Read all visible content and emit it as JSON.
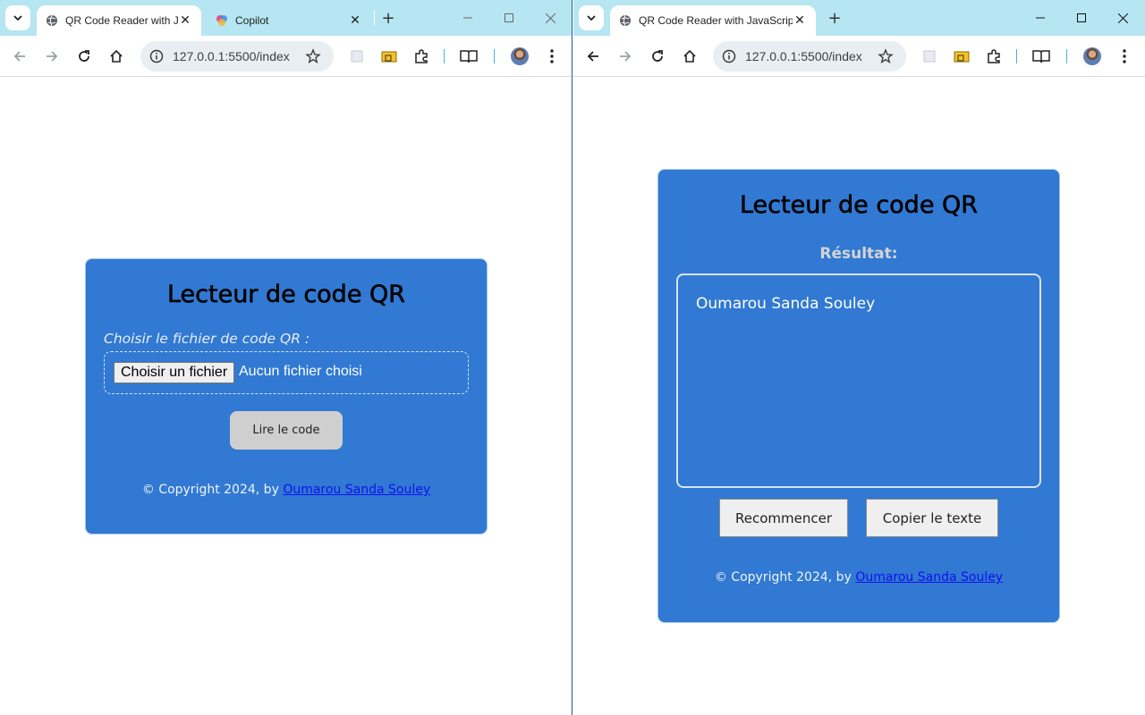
{
  "left_window": {
    "tabs": [
      {
        "title": "QR Code Reader with JavaScript",
        "active": true
      },
      {
        "title": "Copilot",
        "active": false
      }
    ],
    "url": "127.0.0.1:5500/index.html",
    "app": {
      "heading": "Lecteur de code QR",
      "file_label": "Choisir le fichier de code QR :",
      "file_button": "Choisir un fichier",
      "file_status": "Aucun fichier choisi",
      "read_button": "Lire le code",
      "copyright_prefix": "© Copyright 2024, by ",
      "author": "Oumarou Sanda Souley"
    }
  },
  "right_window": {
    "tabs": [
      {
        "title": "QR Code Reader with JavaScript",
        "active": true
      }
    ],
    "url": "127.0.0.1:5500/index.html",
    "app": {
      "heading": "Lecteur de code QR",
      "result_label": "Résultat:",
      "result_text": "Oumarou Sanda Souley",
      "restart_button": "Recommencer",
      "copy_button": "Copier le texte",
      "copyright_prefix": "© Copyright 2024, by ",
      "author": "Oumarou Sanda Souley"
    }
  },
  "icons": [
    "tab-search-icon",
    "globe-icon",
    "copilot-icon",
    "close-icon",
    "plus-icon",
    "minimize-icon",
    "maximize-icon",
    "back-icon",
    "forward-icon",
    "reload-icon",
    "home-icon",
    "info-icon",
    "star-icon",
    "extension-icon",
    "puzzle-icon",
    "reading-list-icon",
    "menu-icon"
  ],
  "colors": {
    "tabstrip": "#b6e6f1",
    "card": "#3179d2",
    "link": "#1010ee"
  }
}
